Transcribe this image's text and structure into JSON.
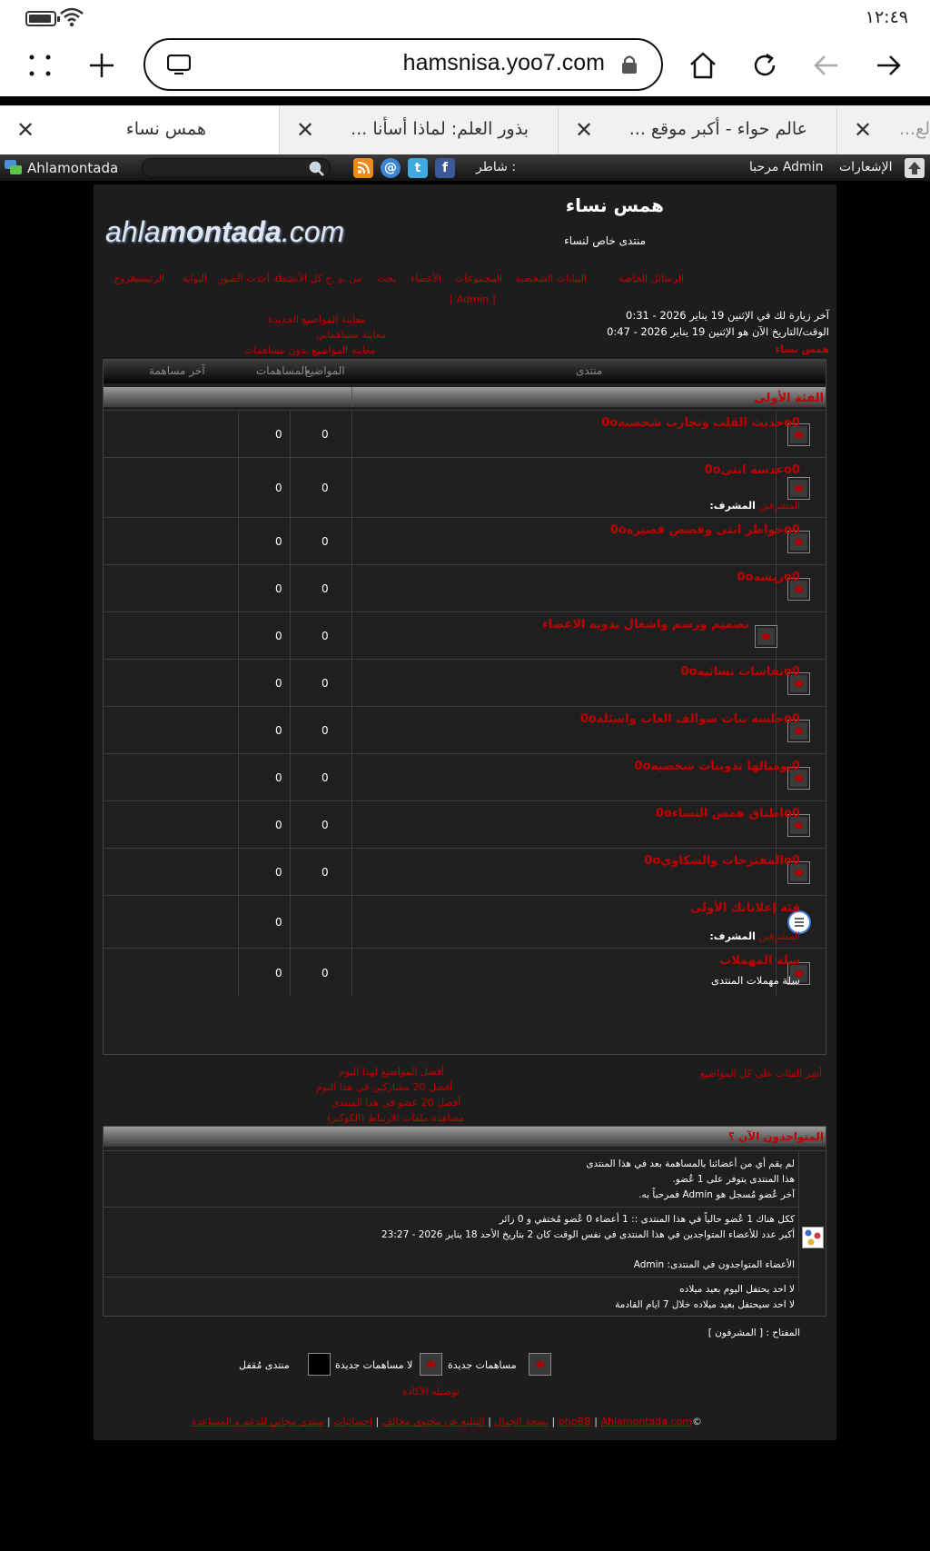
{
  "status": {
    "time": "١٢:٤٩"
  },
  "browser": {
    "url": "hamsnisa.yoo7.com",
    "tabs": [
      {
        "title": "همس نساء"
      },
      {
        "title": "بذور العلم: لماذا أسأنا ..."
      },
      {
        "title": "عالم حواء - أكبر موقع ..."
      },
      {
        "title": "لع..."
      }
    ]
  },
  "forum_toolbar": {
    "brand": "Ahlamontada",
    "share_label": "شاطر :",
    "welcome": "مرحبا Admin",
    "notifications": "الإشعارات"
  },
  "header": {
    "logo_a": "ahla",
    "logo_b": "montada",
    "logo_c": ".com",
    "title": "همس نساء",
    "description": "منتدى خاص لنساء"
  },
  "nav": {
    "items": [
      "الرئيسية",
      "البوابة",
      "أحدث الصور",
      "كل الأنشطة",
      "س .و .ج",
      "بحث",
      "الأعضاء",
      "المجموعات",
      "البيانات الشخصية",
      "الرسائل الخاصة",
      "خروج"
    ],
    "logout_user": "[ Admin ]"
  },
  "info": {
    "last_visit": "آخر زيارة لك في الإثنين 19 يناير 2026 - 0:31",
    "now": "الوقت/التاريخ الآن هو الإثنين 19 يناير 2026 - 0:47",
    "breadcrumb": "همس نساء",
    "links": [
      "معاينة المواضيع الجديدة",
      "معاينة مساهماتي",
      "معاينة المواضيع بدون مساهمات"
    ]
  },
  "table": {
    "headers": {
      "forum": "منتدى",
      "topics": "المواضيع",
      "posts": "المساهمات",
      "last": "آخر مساهمة"
    },
    "category": "الفئة الأولى",
    "forums": [
      {
        "name": "o0حديث القلب وتجارب شخصيه0o",
        "topics": "0",
        "posts": "0"
      },
      {
        "name": "o0عدسه انثى0o",
        "moderator_label": "المشرف:",
        "moderator": "المشرفين",
        "topics": "0",
        "posts": "0"
      },
      {
        "name": "o0خواطر انثى وقصص قصيره0o",
        "topics": "0",
        "posts": "0"
      },
      {
        "name": "o0ريشه0o",
        "topics": "0",
        "posts": "0"
      },
      {
        "name": "تصميم ورسم واشغال يدويه الاعضاء",
        "topics": "0",
        "posts": "0"
      },
      {
        "name": "o0نقاشات نسائيه0o",
        "topics": "0",
        "posts": "0"
      },
      {
        "name": "o0جلسه بنات سوالف العاب واسئلة0o",
        "topics": "0",
        "posts": "0"
      },
      {
        "name": "0يوميالها تدوينات شخصيه0o",
        "topics": "0",
        "posts": "0"
      },
      {
        "name": "o0اطباق همس النساء0o",
        "topics": "0",
        "posts": "0"
      },
      {
        "name": "o0المقترحات والشكاوي0o",
        "topics": "0",
        "posts": "0"
      },
      {
        "name": "فئة إعلاناتك الأولى",
        "moderator_label": "المشرف:",
        "moderator": "المشرفين",
        "topics": "",
        "posts": "0"
      },
      {
        "name": "سلة المهملات",
        "description": "سلة مهملات المنتدى",
        "topics": "0",
        "posts": "0"
      }
    ]
  },
  "below_table": {
    "mark_read": "أشِر الفئات على كل المواضيع",
    "links": [
      "أفضل المواضيع لهذا اليوم",
      "أفضل 20 مشاركين في هذا اليوم",
      "أفضل 20 عضو في هذا المنتدى",
      "مشاهدة ملفات الارتباط (الكوكيز)"
    ]
  },
  "online": {
    "title": "المتواجدون الآن ؟",
    "stats": [
      "لم يقم أي من أعضائنا بالمساهمة بعد في هذا المنتدى",
      "هذا المنتدى يتوفر على 1 عُضو.",
      "آخر عُضو مُسجل هو Admin فمرحباً به."
    ],
    "online_1": "ككل هناك 1 عُضو حالياً في هذا المنتدى :: 1 أعضاء 0 عُضو مُختفي و 0 زائر",
    "online_2": "أكبر عدد للأعضاء المتواجدين في هذا المنتدى في نفس الوقت كان 2 بتاريخ الأحد 18 يناير 2026 - 23:27",
    "online_members": "الأعضاء المتواجدون في المنتدى: Admin",
    "birthday_1": "لا احد يحتفل اليوم بعيد ميلاده",
    "birthday_2": "لا احد سيحتفل بعيد ميلاده خلال 7 ايام القادمة",
    "key": "المفتاح : [ المشرفون ]"
  },
  "legend": {
    "new": "مساهمات جديدة",
    "nonew": "لا مساهمات جديدة",
    "locked": "منتدى مُقفل"
  },
  "footer": {
    "reload": "توصيلة الأكادة",
    "copyright": "©",
    "links": [
      "Ahlamontada.com",
      "phpBB",
      "منتدى مجاني للدعم و المساعدة",
      "إحصائيات",
      "التبليغ عن محتوى مخالف",
      "نسخة الجوال"
    ]
  }
}
